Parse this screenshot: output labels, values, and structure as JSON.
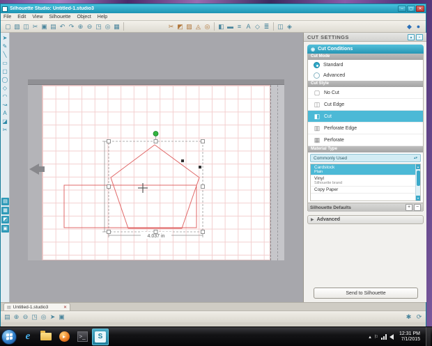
{
  "window": {
    "title": "Silhouette Studio: Untitled-1.studio3",
    "controls": {
      "minimize": "–",
      "maximize": "▢",
      "close": "✕"
    },
    "menu": [
      {
        "name": "menu-file",
        "label": "File"
      },
      {
        "name": "menu-edit",
        "label": "Edit"
      },
      {
        "name": "menu-view",
        "label": "View"
      },
      {
        "name": "menu-silhouette",
        "label": "Silhouette"
      },
      {
        "name": "menu-object",
        "label": "Object"
      },
      {
        "name": "menu-help",
        "label": "Help"
      }
    ]
  },
  "toolbar": {
    "left_icons": [
      {
        "name": "new-document-icon",
        "glyph": "▢"
      },
      {
        "name": "open-icon",
        "glyph": "▧"
      },
      {
        "name": "save-icon",
        "glyph": "◫"
      },
      {
        "name": "cut-icon",
        "glyph": "✂"
      },
      {
        "name": "copy-icon",
        "glyph": "▣"
      },
      {
        "name": "paste-icon",
        "glyph": "▤"
      },
      {
        "name": "undo-icon",
        "glyph": "↶"
      },
      {
        "name": "redo-icon",
        "glyph": "↷"
      },
      {
        "name": "zoom-in-icon",
        "glyph": "⊕"
      },
      {
        "name": "zoom-out-icon",
        "glyph": "⊖"
      },
      {
        "name": "drag-zoom-icon",
        "glyph": "◳"
      },
      {
        "name": "pan-icon",
        "glyph": "◎"
      },
      {
        "name": "fit-page-icon",
        "glyph": "▦"
      }
    ],
    "mid_icons": [
      {
        "name": "send-to-silhouette-icon",
        "glyph": "✂"
      },
      {
        "name": "registration-marks-icon",
        "glyph": "◩"
      },
      {
        "name": "pixscan-icon",
        "glyph": "▨"
      },
      {
        "name": "trace-icon",
        "glyph": "◬"
      },
      {
        "name": "offset-icon",
        "glyph": "◎"
      }
    ],
    "style_icons": [
      {
        "name": "fill-color-icon",
        "glyph": "◧"
      },
      {
        "name": "line-color-icon",
        "glyph": "▬"
      },
      {
        "name": "line-style-icon",
        "glyph": "≡"
      },
      {
        "name": "text-style-icon",
        "glyph": "A"
      },
      {
        "name": "transform-icon",
        "glyph": "◇"
      },
      {
        "name": "align-icon",
        "glyph": "≣"
      }
    ],
    "modify_icons": [
      {
        "name": "replicate-icon",
        "glyph": "◫"
      },
      {
        "name": "modify-icon",
        "glyph": "◈"
      }
    ],
    "right_icons": [
      {
        "name": "library-icon",
        "glyph": "◆"
      },
      {
        "name": "store-icon",
        "glyph": "●"
      }
    ]
  },
  "tools": {
    "top": [
      {
        "name": "select-tool",
        "glyph": "➤"
      },
      {
        "name": "edit-points-tool",
        "glyph": "✎"
      },
      {
        "name": "line-tool",
        "glyph": "╲"
      },
      {
        "name": "rectangle-tool",
        "glyph": "▭"
      },
      {
        "name": "rounded-rectangle-tool",
        "glyph": "▢"
      },
      {
        "name": "ellipse-tool",
        "glyph": "◯"
      },
      {
        "name": "polygon-tool",
        "glyph": "◇"
      },
      {
        "name": "curve-tool",
        "glyph": "◠"
      },
      {
        "name": "freehand-tool",
        "glyph": "↝"
      },
      {
        "name": "text-tool",
        "glyph": "A"
      },
      {
        "name": "eraser-tool",
        "glyph": "◪"
      },
      {
        "name": "knife-tool",
        "glyph": "✂"
      }
    ],
    "bottom": [
      {
        "name": "page-settings-tool",
        "glyph": "▤"
      },
      {
        "name": "grid-settings-tool",
        "glyph": "▦"
      },
      {
        "name": "registration-marks-tool",
        "glyph": "◩"
      },
      {
        "name": "library-tool",
        "glyph": "▣"
      }
    ]
  },
  "canvas": {
    "dimension_label": "4.037 in"
  },
  "cut_settings": {
    "panel_title": "CUT SETTINGS",
    "header_icons": {
      "collapse": "▲",
      "pin": "▪"
    },
    "conditions_header": "Cut Conditions",
    "conditions_icon": "◉",
    "cut_mode_label": "Cut Mode",
    "cut_modes": [
      {
        "name": "radio-standard",
        "label": "Standard",
        "selected": true
      },
      {
        "name": "radio-advanced",
        "label": "Advanced",
        "selected": false
      }
    ],
    "cut_style_label": "Cut Style",
    "cut_styles": [
      {
        "name": "cut-style-no-cut",
        "label": "No Cut",
        "icon": "▢",
        "selected": false
      },
      {
        "name": "cut-style-cut-edge",
        "label": "Cut Edge",
        "icon": "◫",
        "selected": false
      },
      {
        "name": "cut-style-cut",
        "label": "Cut",
        "icon": "◧",
        "selected": true
      },
      {
        "name": "cut-style-perforate-edge",
        "label": "Perforate Edge",
        "icon": "▥",
        "selected": false
      },
      {
        "name": "cut-style-perforate",
        "label": "Perforate",
        "icon": "▦",
        "selected": false
      }
    ],
    "material_type_label": "Material Type",
    "material_filter": "Commonly Used",
    "dropdown_arrows": "▴▾",
    "materials": [
      {
        "name": "material-cardstock",
        "label": "Cardstock",
        "sub": "Plain",
        "selected": true
      },
      {
        "name": "material-vinyl",
        "label": "Vinyl",
        "sub": "Silhouette brand",
        "selected": false
      },
      {
        "name": "material-copy-paper",
        "label": "Copy Paper",
        "sub": "",
        "selected": false
      }
    ],
    "scroll_up": "▴",
    "scroll_down": "▾",
    "defaults_label": "Silhouette Defaults",
    "defaults_plus": "+",
    "defaults_minus": "−",
    "advanced_icon": "▶",
    "advanced_label": "Advanced",
    "send_button": "Send to Silhouette"
  },
  "tab": {
    "label": "Untitled-1.studio3",
    "close": "✕",
    "icon": "▤"
  },
  "bottom_toolbar": {
    "icons": [
      {
        "name": "page-view-icon",
        "glyph": "▤"
      },
      {
        "name": "zoom-in-icon",
        "glyph": "⊕"
      },
      {
        "name": "zoom-out-icon",
        "glyph": "⊖"
      },
      {
        "name": "drag-zoom-icon",
        "glyph": "◳"
      },
      {
        "name": "pan-icon",
        "glyph": "◎"
      },
      {
        "name": "select-view-icon",
        "glyph": "➤"
      },
      {
        "name": "fit-to-window-icon",
        "glyph": "▣"
      }
    ],
    "right_icons": [
      {
        "name": "settings-gear-icon",
        "glyph": "✱"
      },
      {
        "name": "refresh-icon",
        "glyph": "⟳"
      }
    ]
  },
  "taskbar": {
    "ie_label": "e",
    "wmp_glyph": "▸",
    "darkapp_glyph": ">_",
    "silhouette_glyph": "S",
    "hidden_icons": "▴",
    "flag_icon": "⚐",
    "time": "12:31 PM",
    "date": "7/1/2015"
  }
}
